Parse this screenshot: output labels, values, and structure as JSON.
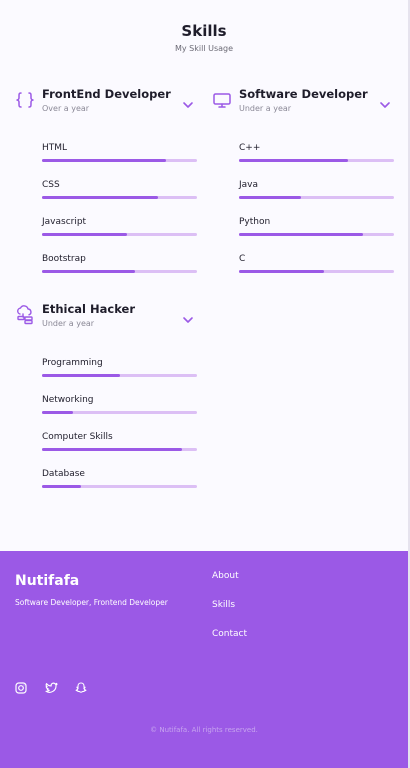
{
  "section": {
    "title": "Skills",
    "subtitle": "My Skill Usage"
  },
  "groups": [
    {
      "title": "FrontEnd Developer",
      "subtitle": "Over a year",
      "icon": "code-braces-icon",
      "skills": [
        {
          "name": "HTML",
          "level": 0.8
        },
        {
          "name": "CSS",
          "level": 0.75
        },
        {
          "name": "Javascript",
          "level": 0.55
        },
        {
          "name": "Bootstrap",
          "level": 0.6
        }
      ]
    },
    {
      "title": "Software Developer",
      "subtitle": "Under a year",
      "icon": "monitor-icon",
      "skills": [
        {
          "name": "C++",
          "level": 0.7
        },
        {
          "name": "Java",
          "level": 0.4
        },
        {
          "name": "Python",
          "level": 0.8
        },
        {
          "name": "C",
          "level": 0.55
        }
      ]
    },
    {
      "title": "Ethical Hacker",
      "subtitle": "Under a year",
      "icon": "cloud-server-icon",
      "skills": [
        {
          "name": "Programming",
          "level": 0.5
        },
        {
          "name": "Networking",
          "level": 0.2
        },
        {
          "name": "Computer Skills",
          "level": 0.9
        },
        {
          "name": "Database",
          "level": 0.25
        }
      ]
    }
  ],
  "footer": {
    "brand": "Nutifafa",
    "tagline": "Software Developer, Frontend Developer",
    "links": [
      "About",
      "Skills",
      "Contact"
    ],
    "social": [
      "instagram-icon",
      "twitter-icon",
      "snapchat-icon"
    ],
    "copyright": "© Nutifafa. All rights reserved."
  },
  "colors": {
    "accent": "#9b59e6",
    "bar_track": "#dcbff5",
    "background": "#fbfaff"
  }
}
